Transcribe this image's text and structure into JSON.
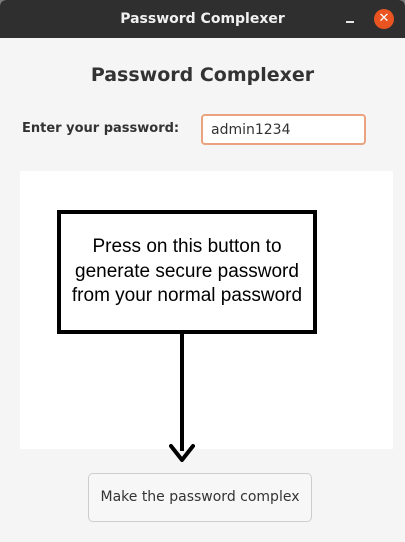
{
  "window": {
    "title": "Password Complexer",
    "minimize_icon": "minimize-icon",
    "close_icon": "close-icon",
    "close_glyph": "✕",
    "accent_color": "#e95420"
  },
  "main": {
    "heading": "Password Complexer",
    "password_label": "Enter your password:",
    "password_value": "admin1234",
    "annotation_text": "Press on this button to generate secure password from your normal password",
    "arrow_icon": "down-arrow-icon",
    "action_button_label": "Make the password complex"
  }
}
